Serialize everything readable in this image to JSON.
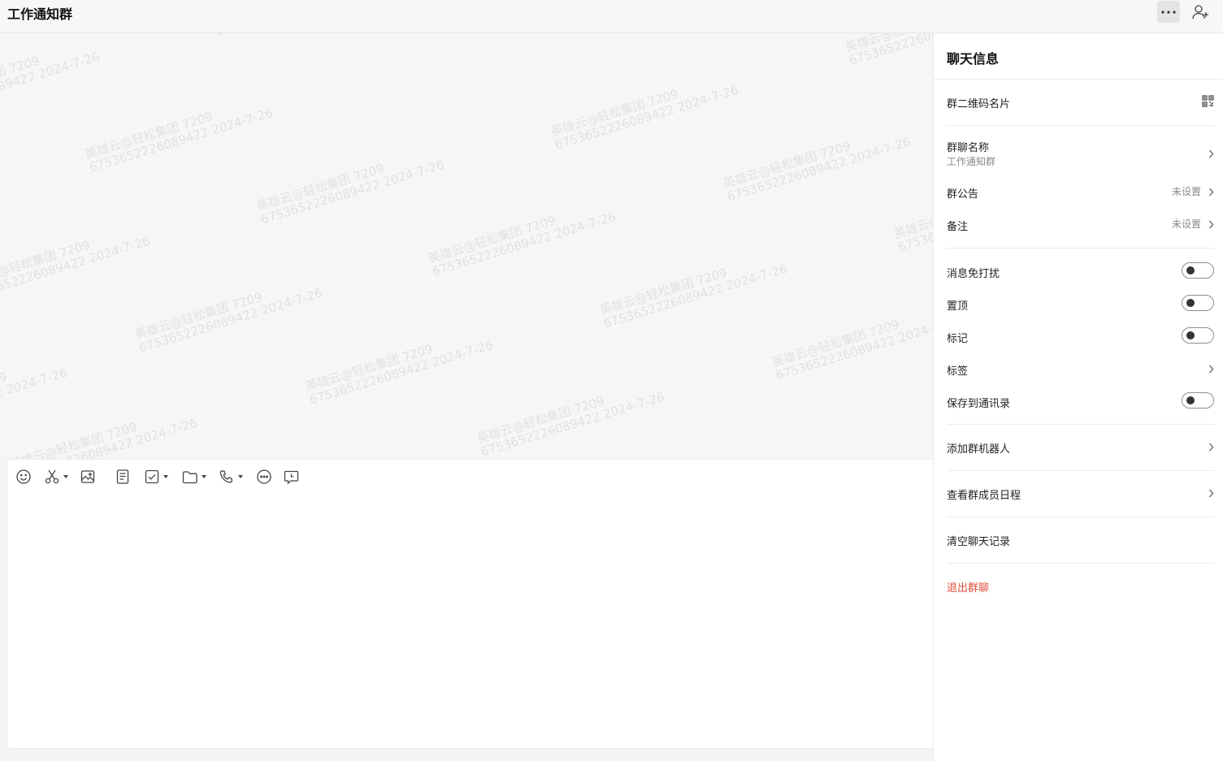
{
  "header": {
    "title": "工作通知群"
  },
  "watermark": {
    "line1": "英雄云@轻松集团 7209",
    "line2": "6753652226089422 2024-7-26"
  },
  "info_panel": {
    "title": "聊天信息",
    "qr_card_label": "群二维码名片",
    "group_name_label": "群聊名称",
    "group_name_value": "工作通知群",
    "announcement_label": "群公告",
    "announcement_value": "未设置",
    "remark_label": "备注",
    "remark_value": "未设置",
    "mute_label": "消息免打扰",
    "pin_label": "置顶",
    "mark_label": "标记",
    "tags_label": "标签",
    "save_contacts_label": "保存到通讯录",
    "add_bot_label": "添加群机器人",
    "member_schedule_label": "查看群成员日程",
    "clear_history_label": "清空聊天记录",
    "leave_group_label": "退出群聊"
  },
  "toggles": {
    "mute": false,
    "pin": false,
    "mark": false,
    "save_contacts": false
  },
  "colors": {
    "danger": "#e2503a",
    "watermark": "#e1e1e1"
  }
}
